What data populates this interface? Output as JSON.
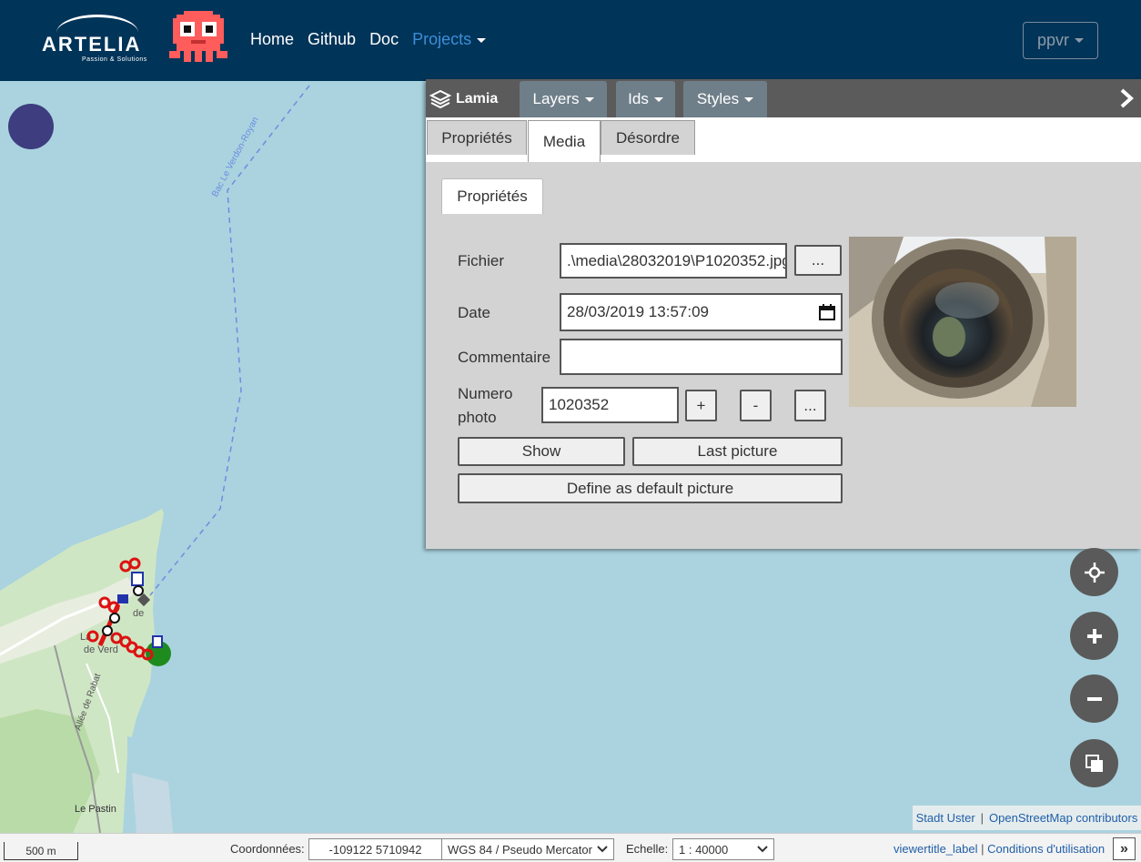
{
  "navbar": {
    "logo_name": "ARTELIA",
    "logo_tagline": "Passion & Solutions",
    "links": [
      {
        "label": "Home"
      },
      {
        "label": "Github"
      },
      {
        "label": "Doc"
      },
      {
        "label": "Projects"
      }
    ],
    "user_label": "ppvr"
  },
  "map": {
    "ferry_label": "Bac Le Verdon-Royan",
    "street_label": "Allée de Rabat",
    "place_label": "Le Pastin",
    "town_label_1": "de",
    "town_label_2": "La",
    "town_label_3": "de Verd"
  },
  "panel": {
    "brand": "Lamia",
    "menus": [
      {
        "label": "Layers"
      },
      {
        "label": "Ids"
      },
      {
        "label": "Styles"
      }
    ],
    "tabs": [
      {
        "label": "Propriétés"
      },
      {
        "label": "Media"
      },
      {
        "label": "Désordre"
      }
    ],
    "subtab": "Propriétés",
    "form": {
      "fichier_label": "Fichier",
      "fichier_value": ".\\media\\28032019\\P1020352.jpg",
      "browse_label": "...",
      "date_label": "Date",
      "date_value": "28/03/2019 13:57:09",
      "commentaire_label": "Commentaire",
      "commentaire_value": "",
      "numero_label_1": "Numero",
      "numero_label_2": "photo",
      "numero_value": "1020352",
      "plus_label": "+",
      "minus_label": "-",
      "more_label": "...",
      "show_label": "Show",
      "last_picture_label": "Last picture",
      "default_picture_label": "Define as default picture"
    }
  },
  "attribution": {
    "source1": "Stadt Uster",
    "separator": "|",
    "source2": "OpenStreetMap contributors"
  },
  "bottombar": {
    "scale": "500 m",
    "coords_label": "Coordonnées:",
    "coords_value": "-109122 5710942",
    "crs_value": "WGS 84 / Pseudo Mercator",
    "echelle_label": "Echelle:",
    "echelle_value": "1 : 40000",
    "link1": "viewertitle_label",
    "separator": "|",
    "link2": "Conditions d'utilisation",
    "more": "»"
  },
  "colors": {
    "navbar": "#003459",
    "sea": "#aad3df",
    "panel": "#d3d3d3",
    "panel_header": "#5b5b5b"
  }
}
